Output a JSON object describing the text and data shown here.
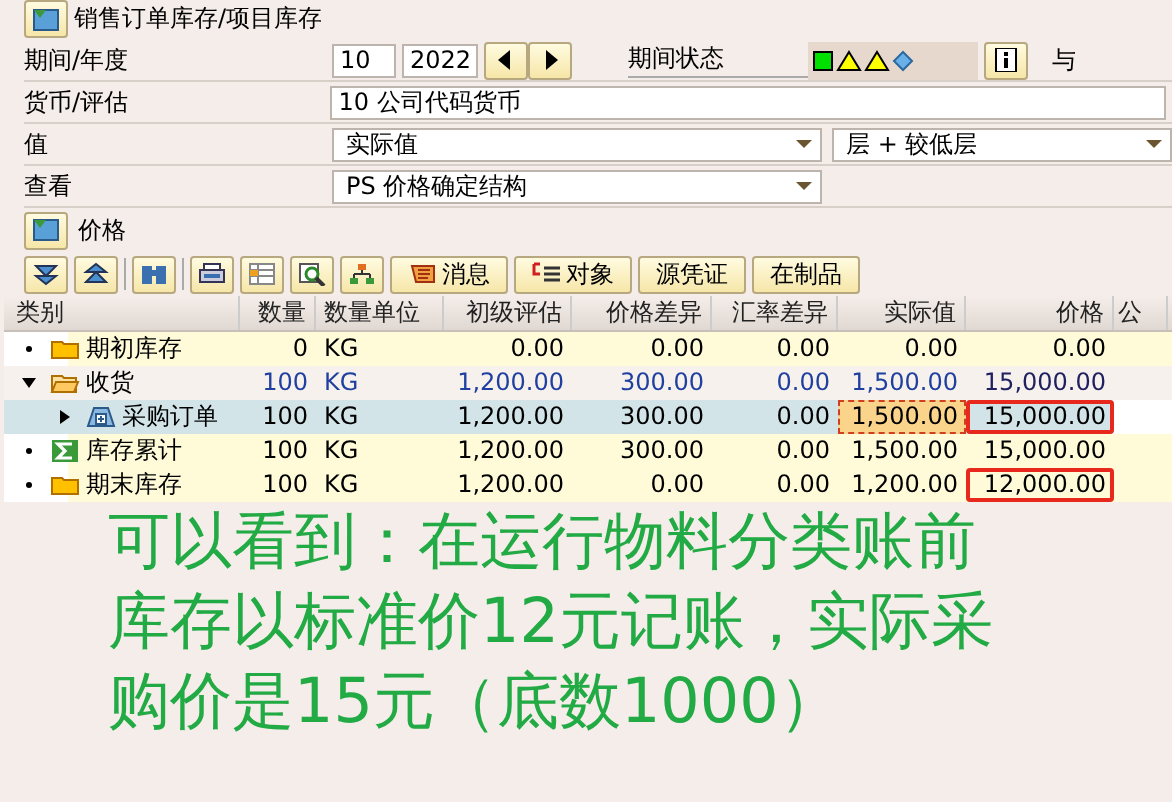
{
  "header": {
    "title": "销售订单库存/项目库存"
  },
  "form": {
    "period_label": "期间/年度",
    "period": "10",
    "year": "2022",
    "status_label": "期间状态",
    "cut_label": "与",
    "fields": [
      {
        "label": "货币/评估",
        "value": "10 公司代码货币",
        "kind": "text"
      },
      {
        "label": "值",
        "value": "实际值",
        "kind": "dropdown",
        "extra": "层 + 较低层"
      },
      {
        "label": "查看",
        "value": "PS 价格确定结构",
        "kind": "dropdown"
      }
    ]
  },
  "section": {
    "title": "价格"
  },
  "toolbar": {
    "buttons": [
      {
        "label": "消息"
      },
      {
        "label": "对象"
      },
      {
        "label": "源凭证"
      },
      {
        "label": "在制品"
      }
    ]
  },
  "table": {
    "category_header": "类别",
    "columns": [
      "数量",
      "数量单位",
      "初级评估",
      "价格差异",
      "汇率差异",
      "实际值",
      "价格",
      "公"
    ],
    "rows": [
      {
        "label": "期初库存",
        "kind": "balance",
        "selected": false,
        "cells": [
          "0",
          "KG",
          "0.00",
          "0.00",
          "0.00",
          "0.00",
          "0.00"
        ]
      },
      {
        "label": "收货",
        "kind": "group",
        "expanded": true,
        "selected": false,
        "cells": [
          "100",
          "KG",
          "1,200.00",
          "300.00",
          "0.00",
          "1,500.00",
          "15,000.00"
        ],
        "children": [
          {
            "label": "采购订单",
            "kind": "item",
            "expanded": false,
            "selected": true,
            "cursor": true,
            "outlined": true,
            "cells": [
              "100",
              "KG",
              "1,200.00",
              "300.00",
              "0.00",
              "1,500.00",
              "15,000.00"
            ]
          }
        ]
      },
      {
        "label": "库存累计",
        "kind": "sum",
        "selected": false,
        "cells": [
          "100",
          "KG",
          "1,200.00",
          "300.00",
          "0.00",
          "1,500.00",
          "15,000.00"
        ]
      },
      {
        "label": "期末库存",
        "kind": "balance",
        "selected": false,
        "outlined": true,
        "cells": [
          "100",
          "KG",
          "1,200.00",
          "0.00",
          "0.00",
          "1,200.00",
          "12,000.00"
        ]
      }
    ]
  },
  "annotation": "可以看到：在运行物料分类账前库存以标准价12元记账，实际采购价是15元（底数1000）"
}
